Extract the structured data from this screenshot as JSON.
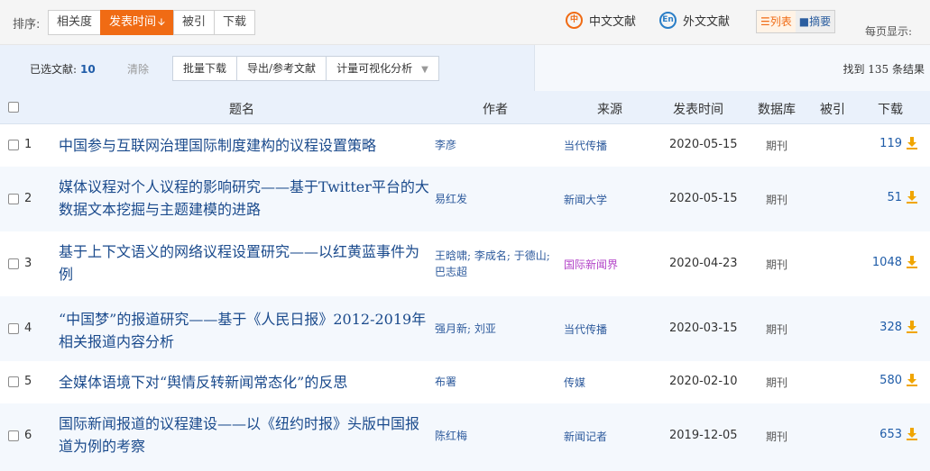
{
  "sortbar": {
    "label": "排序:",
    "buttons": [
      {
        "label": "相关度"
      },
      {
        "label": "发表时间",
        "arrow": "🡫"
      },
      {
        "label": "被引"
      },
      {
        "label": "下载"
      }
    ],
    "lang_cn": {
      "icon": "中",
      "label": "中文文献"
    },
    "lang_en": {
      "icon": "En",
      "label": "外文文献"
    },
    "view_list": "☰列表",
    "view_abstract": "■摘要",
    "per_page": "每页显示:"
  },
  "selbar": {
    "selected_label": "已选文献:",
    "selected_count": "10",
    "clear": "清除",
    "tools": [
      "批量下载",
      "导出/参考文献",
      "计量可视化分析"
    ],
    "found": "找到 135 条结果"
  },
  "table": {
    "headers": {
      "title": "题名",
      "author": "作者",
      "source": "来源",
      "date": "发表时间",
      "db": "数据库",
      "cited": "被引",
      "downloads": "下载"
    },
    "rows": [
      {
        "num": "1",
        "title": "中国参与互联网治理国际制度建构的议程设置策略",
        "author": "李彦",
        "source": "当代传播",
        "date": "2020-05-15",
        "db": "期刊",
        "downloads": "119"
      },
      {
        "num": "2",
        "title": "媒体议程对个人议程的影响研究——基于Twitter平台的大数据文本挖掘与主题建模的进路",
        "author": "易红发",
        "source": "新闻大学",
        "date": "2020-05-15",
        "db": "期刊",
        "downloads": "51"
      },
      {
        "num": "3",
        "title": "基于上下文语义的网络议程设置研究——以红黄蓝事件为例",
        "author": "王晗啸; 李成名; 于德山; 巴志超",
        "source": "国际新闻界",
        "date": "2020-04-23",
        "db": "期刊",
        "downloads": "1048"
      },
      {
        "num": "4",
        "title": "“中国梦”的报道研究——基于《人民日报》2012-2019年相关报道内容分析",
        "author": "强月新; 刘亚",
        "source": "当代传播",
        "date": "2020-03-15",
        "db": "期刊",
        "downloads": "328"
      },
      {
        "num": "5",
        "title": "全媒体语境下对“舆情反转新闻常态化”的反思",
        "author": "布署",
        "source": "传媒",
        "date": "2020-02-10",
        "db": "期刊",
        "downloads": "580"
      },
      {
        "num": "6",
        "title": "国际新闻报道的议程建设——以《纽约时报》头版中国报道为例的考察",
        "author": "陈红梅",
        "source": "新闻记者",
        "date": "2019-12-05",
        "db": "期刊",
        "downloads": "653"
      }
    ]
  },
  "colors": {
    "accent": "#f06b14",
    "link": "#1a4a8c",
    "source_highlight": "#b344c8"
  }
}
